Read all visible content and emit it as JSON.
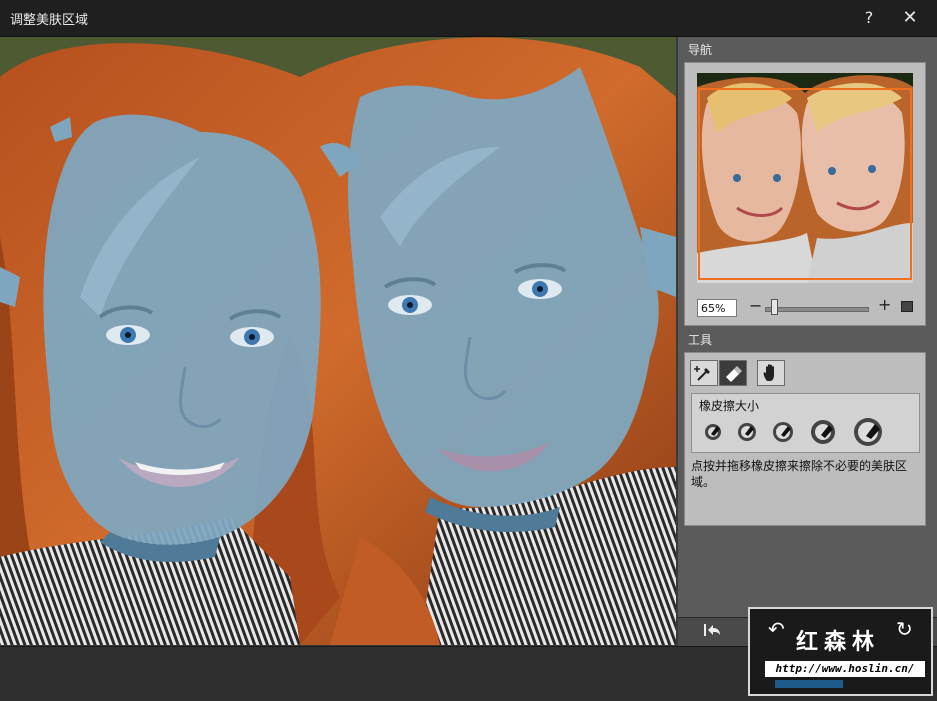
{
  "window": {
    "title": "调整美肤区域",
    "help_label": "?",
    "close_label": "✕"
  },
  "navigator": {
    "label": "导航",
    "zoom_value": "65%",
    "zoom_level": 0.06,
    "minus_label": "−",
    "plus_label": "+"
  },
  "tools": {
    "label": "工具",
    "items": [
      {
        "name": "brush",
        "icon": "brush-plus-icon",
        "active": false
      },
      {
        "name": "eraser",
        "icon": "eraser-icon",
        "active": true
      },
      {
        "name": "hand",
        "icon": "hand-icon",
        "active": false
      }
    ],
    "eraser_size_label": "橡皮擦大小",
    "eraser_sizes": 5,
    "help_text": "点按并拖移橡皮擦来擦除不必要的美肤区域。"
  },
  "panel_bottom": {
    "undo_icon": "undo-icon"
  },
  "watermark": {
    "brand": "红森林",
    "url": "http://www.hoslin.cn/",
    "undo_icon": "undo-icon",
    "redo_icon": "redo-icon"
  },
  "colors": {
    "mask_blue": "#7fa6bf",
    "hair": "#c9602a",
    "accent_orange": "#f07020",
    "titlebar": "#1f1f1f"
  }
}
